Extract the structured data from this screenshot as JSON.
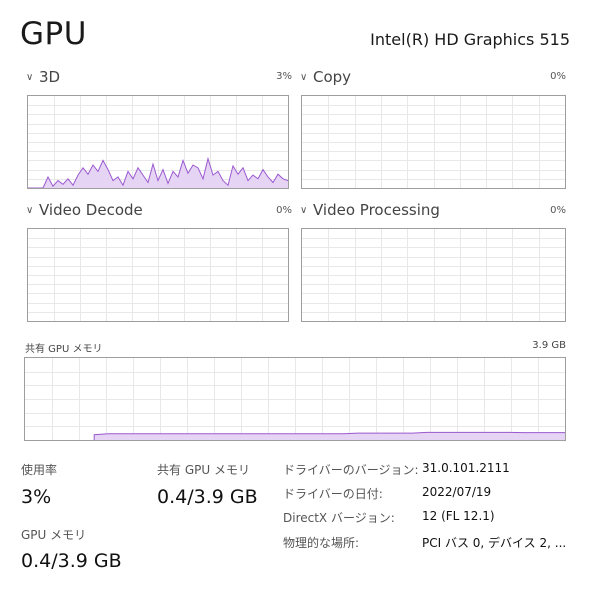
{
  "header": {
    "title": "GPU",
    "adapter_name": "Intel(R) HD Graphics 515"
  },
  "engines": [
    {
      "label": "3D",
      "percent": "3%",
      "utilization": [
        0,
        0,
        0,
        0,
        12,
        2,
        8,
        4,
        10,
        3,
        14,
        22,
        15,
        25,
        18,
        30,
        20,
        8,
        12,
        3,
        18,
        10,
        22,
        14,
        6,
        26,
        8,
        20,
        5,
        18,
        12,
        30,
        16,
        25,
        22,
        10,
        32,
        14,
        18,
        8,
        3,
        24,
        15,
        22,
        8,
        14,
        10,
        20,
        12,
        6,
        15,
        10,
        8
      ]
    },
    {
      "label": "Copy",
      "percent": "0%",
      "utilization": []
    },
    {
      "label": "Video Decode",
      "percent": "0%",
      "utilization": []
    },
    {
      "label": "Video Processing",
      "percent": "0%",
      "utilization": []
    }
  ],
  "shared_memory_chart": {
    "label": "共有 GPU メモリ",
    "max": "3.9 GB",
    "max_gb": 3.9,
    "usage_gb": [
      null,
      null,
      null,
      null,
      null,
      0.25,
      0.3,
      0.3,
      0.3,
      0.3,
      0.3,
      0.3,
      0.3,
      0.3,
      0.3,
      0.3,
      0.3,
      0.3,
      0.3,
      0.3,
      0.3,
      0.3,
      0.3,
      0.3,
      0.33,
      0.33,
      0.33,
      0.33,
      0.33,
      0.36,
      0.36,
      0.36,
      0.36,
      0.36,
      0.36,
      0.36,
      0.35,
      0.35,
      0.35,
      0.35
    ]
  },
  "stats": {
    "utilization": {
      "label": "使用率",
      "value": "3%"
    },
    "shared_memory": {
      "label": "共有 GPU メモリ",
      "value": "0.4/3.9 GB"
    },
    "gpu_memory": {
      "label": "GPU メモリ",
      "value": "0.4/3.9 GB"
    }
  },
  "info": [
    {
      "label": "ドライバーのバージョン:",
      "value": "31.0.101.2111"
    },
    {
      "label": "ドライバーの日付:",
      "value": "2022/07/19"
    },
    {
      "label": "DirectX バージョン:",
      "value": "12 (FL 12.1)"
    },
    {
      "label": "物理的な場所:",
      "value": "PCI バス 0, デバイス 2, ..."
    }
  ],
  "colors": {
    "line": "#9b59d0",
    "fill": "#e6d4f4",
    "grid": "#e8e8e8",
    "border": "#9e9e9e"
  }
}
